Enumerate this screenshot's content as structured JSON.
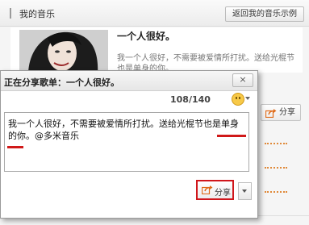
{
  "page": {
    "section_title": "我的音乐",
    "return_button": "返回我的音乐示例",
    "album": {
      "title": "一个人很好。",
      "description": "我一个人很好，不需要被爱情所打扰。送给光棍节也是单身的你。"
    },
    "share_button": "分享"
  },
  "dialog": {
    "title": "正在分享歌单：一个人很好。",
    "close_label": "×",
    "counter": "108/140",
    "message_text": "我一个人很好，不需要被爱情所打扰。送给光棍节也是单身的你。",
    "mention": "@多米音乐",
    "share_button": "分享"
  },
  "colors": {
    "highlight_red": "#d0161b",
    "share_arrow_orange": "#e06c1a",
    "dash_orange": "#e08a3a"
  }
}
